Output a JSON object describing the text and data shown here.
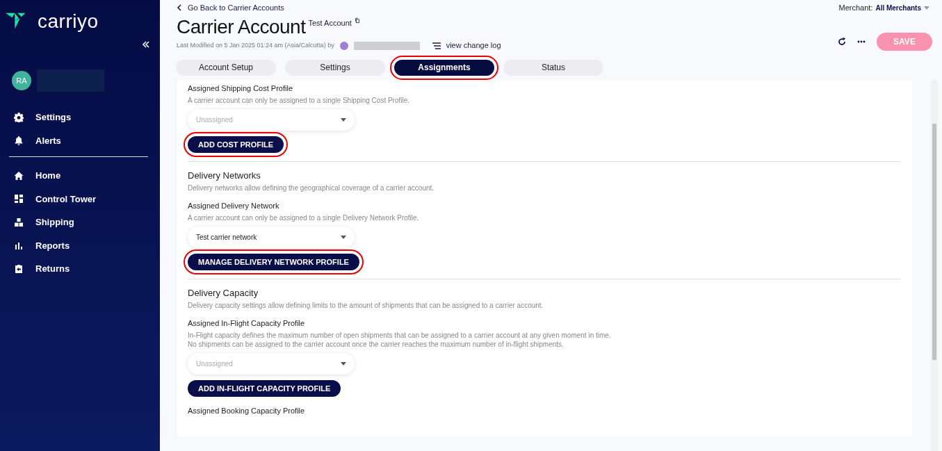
{
  "sidebar": {
    "logo": "carriyo",
    "user": {
      "initials": "RA"
    },
    "groups": [
      {
        "items": [
          {
            "label": "Settings"
          },
          {
            "label": "Alerts"
          }
        ]
      },
      {
        "items": [
          {
            "label": "Home"
          },
          {
            "label": "Control Tower"
          },
          {
            "label": "Shipping"
          },
          {
            "label": "Reports"
          },
          {
            "label": "Returns"
          }
        ]
      }
    ]
  },
  "header": {
    "back_link": "Go Back to Carrier Accounts",
    "title": "Carrier Account",
    "subtitle": "Test Account",
    "last_modified": "Last Modified on 5 Jan 2025 01:24 am (Asia/Calcutta) by",
    "change_log": "view change log",
    "merchant_label": "Merchant:",
    "merchant_value": "All Merchants",
    "save": {
      "label": "SAVE",
      "disabled": true
    }
  },
  "tabs": [
    {
      "label": "Account Setup",
      "selected": false,
      "highlighted": false
    },
    {
      "label": "Settings",
      "selected": false,
      "highlighted": false
    },
    {
      "label": "Assignments",
      "selected": true,
      "highlighted": true
    },
    {
      "label": "Status",
      "selected": false,
      "highlighted": false
    }
  ],
  "sections": [
    {
      "fields": [
        {
          "label": "Assigned Shipping Cost Profile",
          "description": [
            "A carrier account can only be assigned to a single Shipping Cost Profile."
          ],
          "select": {
            "placeholder": "Unassigned"
          },
          "button": {
            "label": "ADD COST PROFILE",
            "highlighted": true
          }
        }
      ]
    },
    {
      "heading": "Delivery Networks",
      "description": "Delivery networks allow defining the geographical coverage of a carrier account.",
      "fields": [
        {
          "label": "Assigned Delivery Network",
          "description": [
            "A carrier account can only be assigned to a single Delivery Network Profile."
          ],
          "select": {
            "value": "Test carrier network"
          },
          "button": {
            "label": "MANAGE DELIVERY NETWORK PROFILE",
            "highlighted": true
          }
        }
      ]
    },
    {
      "heading": "Delivery Capacity",
      "description": "Delivery capacity settings allow defining limits to the amount of shipments that can be assigned to a carrier account.",
      "fields": [
        {
          "label": "Assigned In-Flight Capacity Profile",
          "description": [
            "In-Flight capacity defines the maximum number of open shipments that can be assigned to a carrier account at any given moment in time.",
            "No shipments can be assigned to the carrier account once the carrier reaches the maximum number of in-flight shipments."
          ],
          "select": {
            "placeholder": "Unassigned"
          },
          "button": {
            "label": "ADD IN-FLIGHT CAPACITY PROFILE",
            "highlighted": false
          }
        },
        {
          "label": "Assigned Booking Capacity Profile"
        }
      ]
    }
  ]
}
